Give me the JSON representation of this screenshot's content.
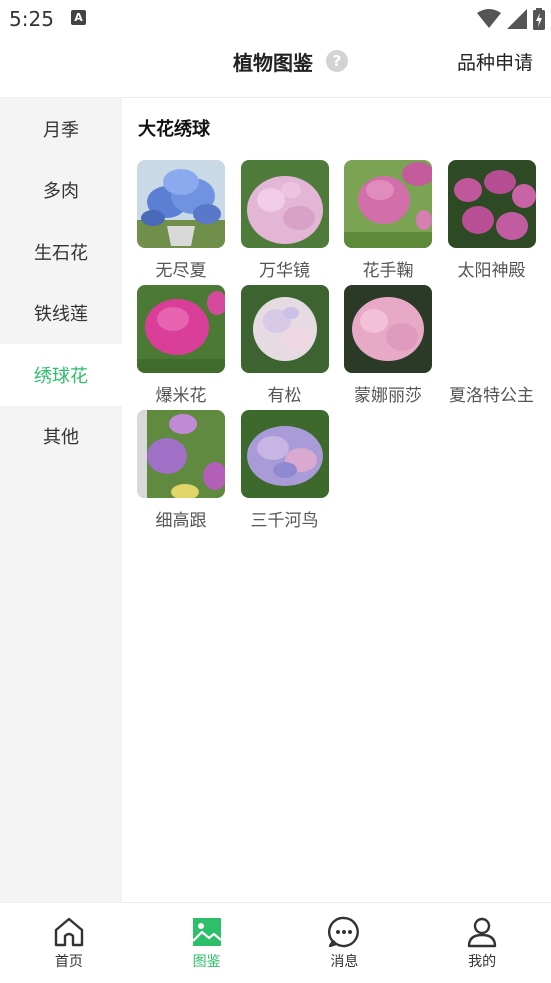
{
  "status_bar": {
    "time": "5:25",
    "notification_letter": "A"
  },
  "header": {
    "title": "植物图鉴",
    "help_symbol": "?",
    "apply_label": "品种申请"
  },
  "sidebar": {
    "items": [
      {
        "label": "月季"
      },
      {
        "label": "多肉"
      },
      {
        "label": "生石花"
      },
      {
        "label": "铁线莲"
      },
      {
        "label": "绣球花",
        "active": true
      },
      {
        "label": "其他"
      }
    ]
  },
  "content": {
    "section_title": "大花绣球",
    "varieties": [
      {
        "name": "无尽夏",
        "photo": "blue-hydrangea-pot"
      },
      {
        "name": "万华镜",
        "photo": "light-pink-hydrangea"
      },
      {
        "name": "花手鞠",
        "photo": "pink-hydrangea-garden"
      },
      {
        "name": "太阳神殿",
        "photo": "magenta-hydrangea-bush"
      },
      {
        "name": "爆米花",
        "photo": "hot-pink-hydrangea"
      },
      {
        "name": "有松",
        "photo": "pale-hydrangea"
      },
      {
        "name": "蒙娜丽莎",
        "photo": "soft-pink-hydrangea"
      },
      {
        "name": "夏洛特公主",
        "photo": ""
      },
      {
        "name": "细高跟",
        "photo": "purple-hydrangea-pot"
      },
      {
        "name": "三千河鸟",
        "photo": "lilac-hydrangea"
      }
    ]
  },
  "bottom_nav": {
    "items": [
      {
        "label": "首页",
        "icon": "home-icon"
      },
      {
        "label": "图鉴",
        "icon": "picture-icon",
        "active": true
      },
      {
        "label": "消息",
        "icon": "message-icon"
      },
      {
        "label": "我的",
        "icon": "profile-icon"
      }
    ]
  },
  "colors": {
    "accent": "#2dbf6a",
    "sidebar_bg": "#f4f4f4",
    "text": "#222222"
  }
}
